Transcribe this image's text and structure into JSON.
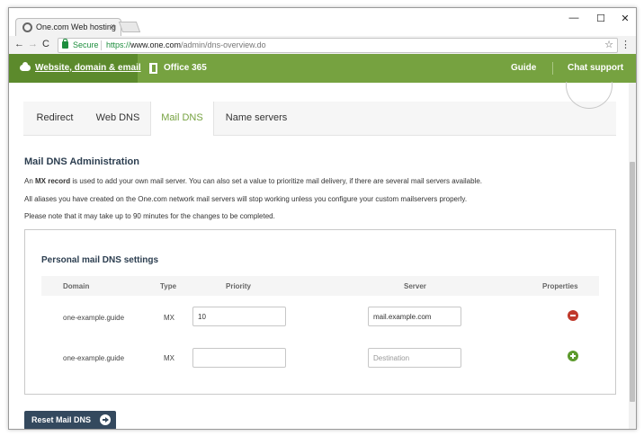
{
  "browser": {
    "tab_title": "One.com Web hosting",
    "tab_close": "×",
    "win_minimize": "—",
    "win_maximize": "☐",
    "win_close": "✕",
    "back": "←",
    "forward": "→",
    "reload": "C",
    "secure_label": "Secure",
    "url_scheme": "https://",
    "url_host": "www.one.com",
    "url_path": "/admin/dns-overview.do",
    "star": "☆",
    "menu": "⋮"
  },
  "sitenav": {
    "website": "Website, domain & email",
    "office": "Office 365",
    "guide": "Guide",
    "chat": "Chat support"
  },
  "dns_tabs": [
    {
      "label": "Redirect"
    },
    {
      "label": "Web DNS"
    },
    {
      "label": "Mail DNS"
    },
    {
      "label": "Name servers"
    }
  ],
  "admin": {
    "title": "Mail DNS Administration",
    "para1_a": "An ",
    "para1_b": "MX record",
    "para1_c": " is used to add your own mail server. You can also set a value to prioritize mail delivery, if there are several mail servers available.",
    "para2": "All aliases you have created on the One.com network mail servers will stop working unless you configure your custom mailservers properly.",
    "para3": "Please note that it may take up to 90 minutes for the changes to be completed."
  },
  "panel": {
    "title": "Personal mail DNS settings",
    "headers": {
      "domain": "Domain",
      "type": "Type",
      "priority": "Priority",
      "server": "Server",
      "properties": "Properties"
    },
    "rows": [
      {
        "domain": "one-example.guide",
        "type": "MX",
        "priority_value": "10",
        "priority_placeholder": "",
        "server_value": "mail.example.com",
        "server_placeholder": ""
      },
      {
        "domain": "one-example.guide",
        "type": "MX",
        "priority_value": "",
        "priority_placeholder": "",
        "server_value": "",
        "server_placeholder": "Destination"
      }
    ]
  },
  "reset_button": "Reset Mail DNS",
  "colors": {
    "brand_green": "#76a240",
    "dark_green": "#5c8a2c",
    "navy": "#34495e",
    "remove_red": "#c0392b"
  }
}
